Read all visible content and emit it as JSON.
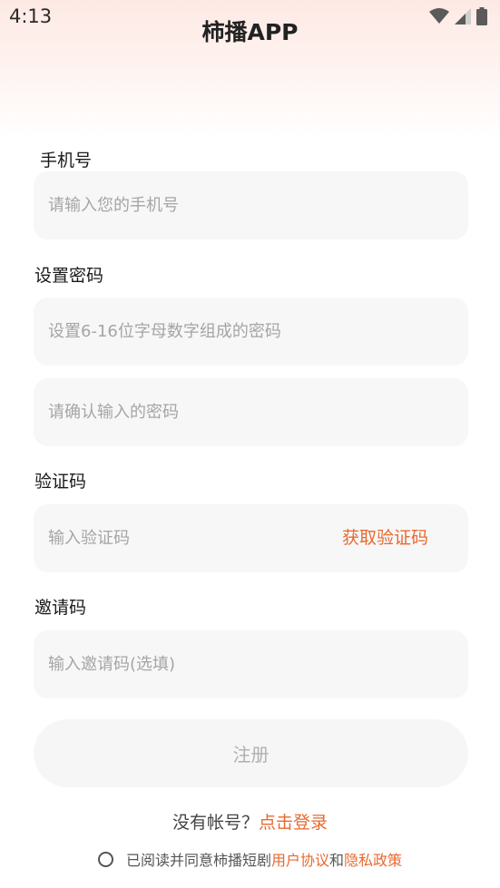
{
  "status_bar": {
    "time": "4:13"
  },
  "header": {
    "title": "柿播APP"
  },
  "form": {
    "phone": {
      "label": "手机号",
      "placeholder": "请输入您的手机号"
    },
    "password": {
      "label": "设置密码",
      "placeholder": "设置6-16位字母数字组成的密码",
      "confirm_placeholder": "请确认输入的密码"
    },
    "code": {
      "label": "验证码",
      "placeholder": "输入验证码",
      "get_code": "获取验证码"
    },
    "invite": {
      "label": "邀请码",
      "placeholder": "输入邀请码(选填)"
    },
    "submit_label": "注册"
  },
  "footer": {
    "no_account": "没有帐号？",
    "login_link": "点击登录",
    "agree_prefix": "已阅读并同意柿播短剧",
    "user_agreement": "用户协议",
    "and": "和",
    "privacy_policy": "隐私政策"
  },
  "colors": {
    "accent": "#e8692f",
    "field_bg": "#f7f7f7",
    "placeholder": "#a5a5a5"
  },
  "icons": [
    "wifi-icon",
    "signal-icon",
    "battery-icon"
  ]
}
